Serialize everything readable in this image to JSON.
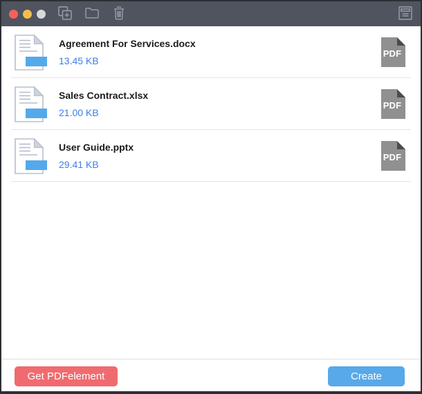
{
  "titlebar": {
    "traffic_lights": [
      {
        "name": "close",
        "color": "#f4615d"
      },
      {
        "name": "minimize",
        "color": "#f5bd4b"
      },
      {
        "name": "zoom",
        "color": "#d8d8d8"
      }
    ],
    "toolbar_icons": [
      "add-file-icon",
      "open-folder-icon",
      "delete-icon"
    ],
    "right_icon": "file-list-icon",
    "bg_color": "#4f545f"
  },
  "files": [
    {
      "name": "Agreement For Services.docx",
      "size": "13.45 KB",
      "badge": "PDF"
    },
    {
      "name": "Sales Contract.xlsx",
      "size": "21.00 KB",
      "badge": "PDF"
    },
    {
      "name": "User Guide.pptx",
      "size": "29.41 KB",
      "badge": "PDF"
    }
  ],
  "footer": {
    "get_button": "Get PDFelement",
    "create_button": "Create"
  },
  "colors": {
    "create_blue": "#58a9e9",
    "get_red": "#ef6b6f",
    "file_size_blue": "#3d7ee8",
    "doc_accent_blue": "#55a9ea",
    "pdf_badge_gray": "#909090",
    "separator": "#e4e4e4"
  }
}
